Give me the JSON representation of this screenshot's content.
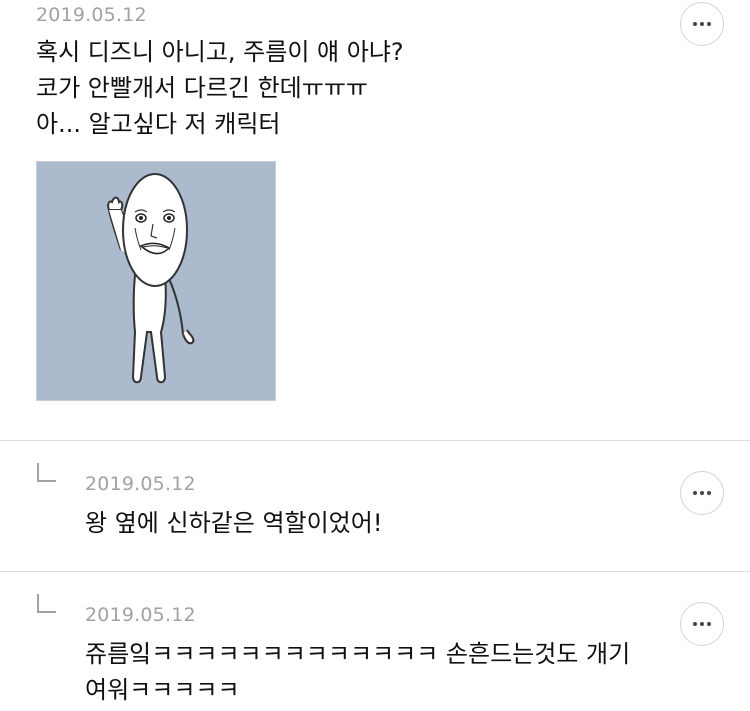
{
  "comments": [
    {
      "date": "2019.05.12",
      "lines": [
        "혹시 디즈니 아니고, 주름이 얘 아냐?",
        "코가 안빨개서 다르긴 한데ㅠㅠㅠ",
        "아... 알고싶다 저 캐릭터"
      ],
      "more_icon": "ellipsis-icon",
      "sticker_icon": "wrinkle-character-sticker",
      "sticker_bg": "#abbacd"
    },
    {
      "date": "2019.05.12",
      "lines": [
        "왕 옆에 신하같은 역할이었어!"
      ],
      "reply_icon": "reply-arrow-icon",
      "more_icon": "ellipsis-icon"
    },
    {
      "date": "2019.05.12",
      "lines": [
        "쥬름잌ㅋㅋㅋㅋㅋㅋㅋㅋㅋㅋㅋㅋㅋ 손흔드는것도 개기",
        "여워ㅋㅋㅋㅋㅋ"
      ],
      "reply_icon": "reply-arrow-icon",
      "more_icon": "ellipsis-icon"
    }
  ],
  "colors": {
    "date": "#a2a2a2",
    "text": "#111111",
    "divider": "#dedede",
    "button_border": "#d4d4d4"
  }
}
